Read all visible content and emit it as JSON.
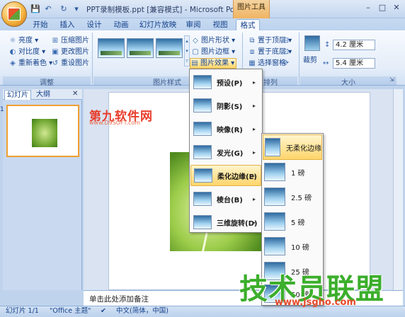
{
  "window": {
    "title": "PPT录制模板.ppt [兼容模式] - Microsoft PowerP...",
    "context_group": "图片工具",
    "controls": [
      "–",
      "□",
      "✕"
    ]
  },
  "qat": {
    "save": "💾",
    "undo": "↶",
    "redo": "↻",
    "more": "▾"
  },
  "tabs": [
    "开始",
    "插入",
    "设计",
    "动画",
    "幻灯片放映",
    "审阅",
    "视图",
    "格式"
  ],
  "ribbon": {
    "adjust": {
      "label": "调整",
      "buttons": [
        "亮度 ▾",
        "压缩图片",
        "对比度 ▾",
        "更改图片",
        "重新着色 ▾",
        "重设图片"
      ]
    },
    "styles": {
      "label": "图片样式"
    },
    "style_cmds": [
      "图片形状 ▾",
      "图片边框 ▾",
      "图片效果 ▾"
    ],
    "arrange": {
      "label": "排列",
      "buttons": [
        "置于顶层 ▾",
        "置于底层 ▾",
        "选择窗格"
      ]
    },
    "size": {
      "label": "大小",
      "crop": "裁剪",
      "height": "4.2 厘米",
      "width": "5.4 厘米"
    }
  },
  "pane": {
    "tabs": [
      "幻灯片",
      "大纲"
    ],
    "close": "✕",
    "slide_number": "1"
  },
  "effects_menu": [
    {
      "label": "预设(P)",
      "arrow": "▸"
    },
    {
      "label": "阴影(S)",
      "arrow": "▸"
    },
    {
      "label": "映像(R)",
      "arrow": "▸"
    },
    {
      "label": "发光(G)",
      "arrow": "▸"
    },
    {
      "label": "柔化边缘(E)",
      "arrow": "▸"
    },
    {
      "label": "棱台(B)",
      "arrow": "▸"
    },
    {
      "label": "三维旋转(D)",
      "arrow": "▸"
    }
  ],
  "soft_edges_submenu": [
    "无柔化边缘",
    "1 磅",
    "2.5 磅",
    "5 磅",
    "10 磅",
    "25 磅",
    "50 磅"
  ],
  "notes_placeholder": "单击此处添加备注",
  "status": {
    "slide": "幻灯片 1/1",
    "theme": "\"Office 主题\"",
    "lang": "中文(简体，中国)"
  },
  "watermarks": {
    "top": "第九软件网",
    "top_url": "www.D9SOFT.com",
    "bottom": "技术员联盟",
    "bottom_url": "www.jsgho.com"
  }
}
